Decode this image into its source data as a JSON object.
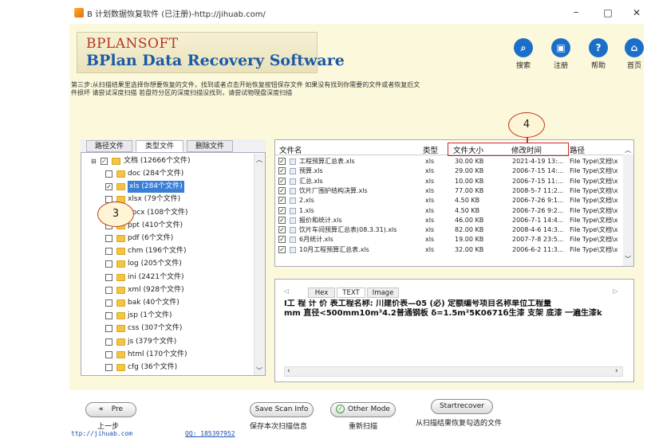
{
  "window": {
    "title": "B 计划数据恢复软件 (已注册)-http://jihuab.com/",
    "minimize": "–",
    "maximize": "□",
    "close": "✕"
  },
  "brand": {
    "top": "BPLANSOFT",
    "main": "BPlan Data Recovery Software"
  },
  "toolbar": [
    {
      "icon": "search-icon",
      "glyph": "⌕",
      "label": "搜索"
    },
    {
      "icon": "register-icon",
      "glyph": "▣",
      "label": "注册"
    },
    {
      "icon": "help-icon",
      "glyph": "?",
      "label": "帮助"
    },
    {
      "icon": "home-icon",
      "glyph": "⌂",
      "label": "首页"
    }
  ],
  "instructions": {
    "line1": "第三步:从扫描结果里选择你想要恢复的文件，找到或者点击开始恢复按钮保存文件 如果没有找到你需要的文件或者恢复后文",
    "line2": "件损坏 请尝试深度扫描 若盘符分区的深度扫描没找到，请尝试物理盘深度扫描"
  },
  "left_tabs": [
    "路径文件",
    "类型文件",
    "删除文件"
  ],
  "tree": {
    "root": "文档 (12666个文件)",
    "items": [
      {
        "label": "doc (284个文件)",
        "checked": false
      },
      {
        "label": "xls (284个文件)",
        "checked": true,
        "selected": true
      },
      {
        "label": "xlsx (79个文件)",
        "checked": false
      },
      {
        "label": "docx (108个文件)",
        "checked": false
      },
      {
        "label": "ppt (410个文件)",
        "checked": false
      },
      {
        "label": "pdf (6个文件)",
        "checked": false
      },
      {
        "label": "chm (196个文件)",
        "checked": false
      },
      {
        "label": "log (205个文件)",
        "checked": false
      },
      {
        "label": "ini (2421个文件)",
        "checked": false
      },
      {
        "label": "xml (928个文件)",
        "checked": false
      },
      {
        "label": "bak (40个文件)",
        "checked": false
      },
      {
        "label": "jsp (1个文件)",
        "checked": false
      },
      {
        "label": "css (307个文件)",
        "checked": false
      },
      {
        "label": "js (379个文件)",
        "checked": false
      },
      {
        "label": "html (170个文件)",
        "checked": false
      },
      {
        "label": "cfg (36个文件)",
        "checked": false
      }
    ]
  },
  "file_table": {
    "headers": {
      "name": "文件名",
      "type": "类型",
      "size": "文件大小",
      "modified": "修改时间",
      "path": "路径"
    },
    "rows": [
      {
        "name": "工程预算汇总表.xls",
        "type": "xls",
        "size": "30.00 KB",
        "modified": "2021-4-19 13:...",
        "path": "File Type\\文档\\x"
      },
      {
        "name": "预算.xls",
        "type": "xls",
        "size": "29.00 KB",
        "modified": "2006-7-15 14:...",
        "path": "File Type\\文档\\x"
      },
      {
        "name": "汇总.xls",
        "type": "xls",
        "size": "10.00 KB",
        "modified": "2006-7-15 11:...",
        "path": "File Type\\文档\\x"
      },
      {
        "name": "饮片厂围护结构决算.xls",
        "type": "xls",
        "size": "77.00 KB",
        "modified": "2008-5-7 11:2...",
        "path": "File Type\\文档\\x"
      },
      {
        "name": "2.xls",
        "type": "xls",
        "size": "4.50 KB",
        "modified": "2006-7-26 9:1...",
        "path": "File Type\\文档\\x"
      },
      {
        "name": "1.xls",
        "type": "xls",
        "size": "4.50 KB",
        "modified": "2006-7-26 9:2...",
        "path": "File Type\\文档\\x"
      },
      {
        "name": "报价和统计.xls",
        "type": "xls",
        "size": "46.00 KB",
        "modified": "2006-7-1 14:4...",
        "path": "File Type\\文档\\x"
      },
      {
        "name": "饮片车间预算汇总表(08.3.31).xls",
        "type": "xls",
        "size": "82.00 KB",
        "modified": "2008-4-6 14:3...",
        "path": "File Type\\文档\\x"
      },
      {
        "name": "6月统计.xls",
        "type": "xls",
        "size": "19.00 KB",
        "modified": "2007-7-8 23:5...",
        "path": "File Type\\文档\\x"
      },
      {
        "name": "10月工程预算汇总表.xls",
        "type": "xls",
        "size": "32.00 KB",
        "modified": "2006-6-2 11:3...",
        "path": "File Type\\文档\\x"
      }
    ]
  },
  "preview": {
    "tabs": [
      "Hex",
      "TEXT",
      "Image"
    ],
    "line1": "I工 程 计 价 表工程名称: 川建价表—05 (必) 定额编号项目名称单位工程量",
    "line2": "mm 直径<500mm10m³4.2普通钢板 δ=1.5m²5K0671б生漆 支架 底漆 一遍生漆k"
  },
  "bottom": {
    "pre_button": "Pre",
    "pre_label": "上一步",
    "save_scan_button": "Save Scan Info",
    "save_scan_label": "保存本次扫描信息",
    "other_mode_button": "Other Mode",
    "other_mode_label": "重新扫描",
    "recover_button": "Startrecover",
    "recover_label": "从扫描结果恢复勾选的文件",
    "site_link": "ttp://jihuab.com",
    "qq": "QQ: 185397952"
  },
  "annotations": {
    "three": "3",
    "four": "4"
  },
  "colors": {
    "accent": "#1b6fc9",
    "cream": "#fbf8dc",
    "annotation_red": "#d7261c",
    "selected": "#3a7fd6"
  }
}
